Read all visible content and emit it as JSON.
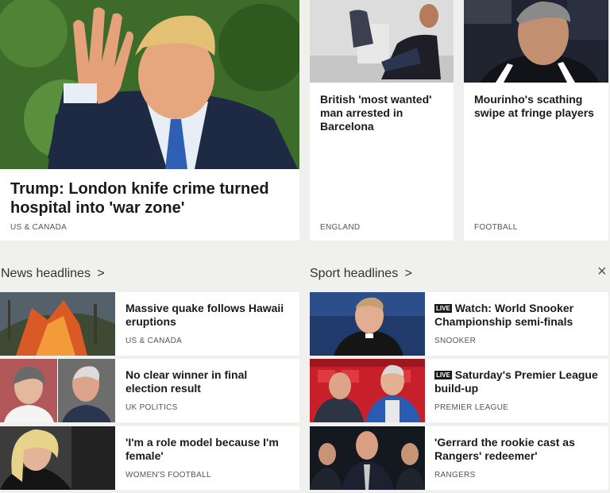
{
  "top_stories": [
    {
      "headline": "Trump: London knife crime turned hospital into 'war zone'",
      "tag": "US & CANADA"
    },
    {
      "headline": "British 'most wanted' man arrested in Barcelona",
      "tag": "ENGLAND"
    },
    {
      "headline": "Mourinho's scathing swipe at fringe players",
      "tag": "FOOTBALL"
    }
  ],
  "news": {
    "title": "News headlines",
    "chevron": ">",
    "items": [
      {
        "headline": "Massive quake follows Hawaii eruptions",
        "tag": "US & CANADA"
      },
      {
        "headline": "No clear winner in final election result",
        "tag": "UK POLITICS"
      },
      {
        "headline": "'I'm a role model because I'm female'",
        "tag": "WOMEN'S FOOTBALL"
      }
    ]
  },
  "sport": {
    "title": "Sport headlines",
    "chevron": ">",
    "close": "×",
    "live_label": "LIVE",
    "items": [
      {
        "headline": "Watch: World Snooker Championship semi-finals",
        "tag": "SNOOKER",
        "live": true
      },
      {
        "headline": "Saturday's Premier League build-up",
        "tag": "PREMIER LEAGUE",
        "live": true
      },
      {
        "headline": "'Gerrard the rookie cast as Rangers' redeemer'",
        "tag": "RANGERS",
        "live": false
      }
    ]
  }
}
